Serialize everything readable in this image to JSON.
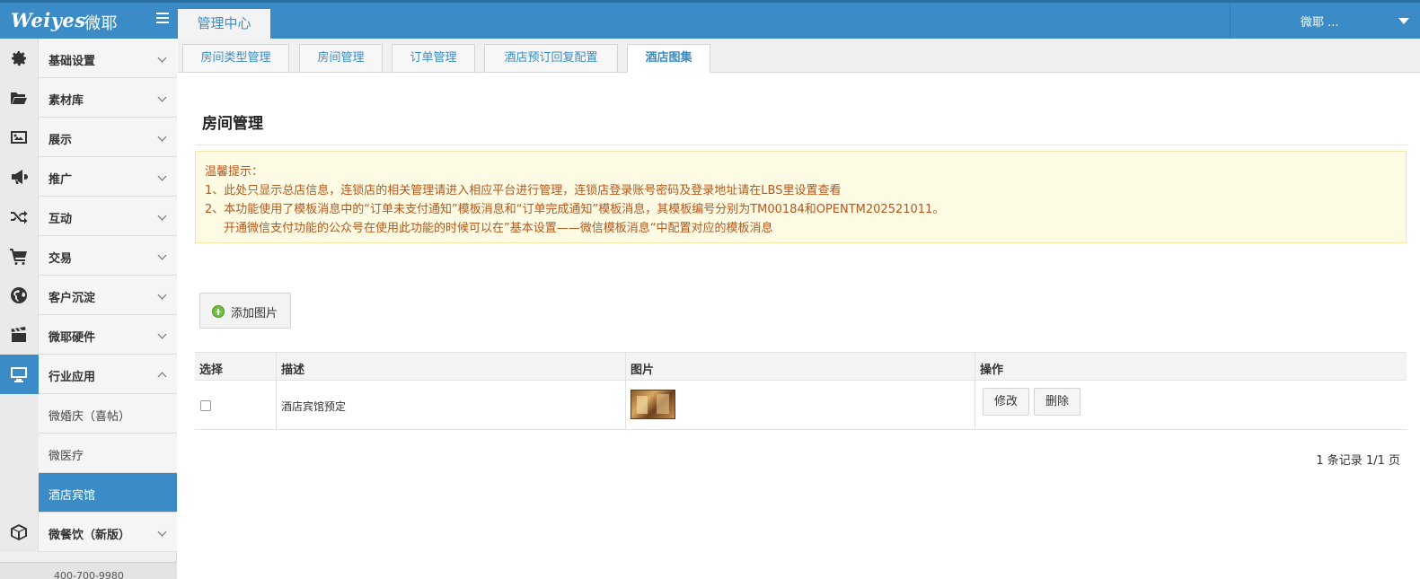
{
  "header": {
    "logo_text": "Weiyes",
    "logo_cn": "微耶",
    "active_tab": "管理中心",
    "user_name": "微耶 ..."
  },
  "sidebar": {
    "items": [
      {
        "label": "基础设置",
        "icon": "gear-icon"
      },
      {
        "label": "素材库",
        "icon": "folder-open-icon"
      },
      {
        "label": "展示",
        "icon": "image-icon"
      },
      {
        "label": "推广",
        "icon": "megaphone-icon"
      },
      {
        "label": "互动",
        "icon": "shuffle-icon"
      },
      {
        "label": "交易",
        "icon": "cart-icon"
      },
      {
        "label": "客户沉淀",
        "icon": "globe-icon"
      },
      {
        "label": "微耶硬件",
        "icon": "clapperboard-icon"
      },
      {
        "label": "行业应用",
        "icon": "monitor-icon"
      }
    ],
    "sub_items": [
      {
        "label": "微婚庆（喜帖）"
      },
      {
        "label": "微医疗"
      },
      {
        "label": "酒店宾馆"
      }
    ],
    "last_item": {
      "label": "微餐饮（新版）",
      "icon": "cube-icon"
    },
    "footer_text": "400-700-9980"
  },
  "subtabs": [
    "房间类型管理",
    "房间管理",
    "订单管理",
    "酒店预订回复配置",
    "酒店图集"
  ],
  "page": {
    "title": "房间管理",
    "notice": {
      "heading": "温馨提示：",
      "line1": "1、此处只显示总店信息，连锁店的相关管理请进入相应平台进行管理，连锁店登录账号密码及登录地址请在LBS里设置查看",
      "line2": "2、本功能使用了模板消息中的“订单未支付通知”模板消息和“订单完成通知”模板消息，其模板编号分别为TM00184和OPENTM202521011。",
      "line3": "开通微信支付功能的公众号在使用此功能的时候可以在”基本设置——微信模板消息“中配置对应的模板消息"
    },
    "add_button": "添加图片",
    "table": {
      "headers": [
        "选择",
        "描述",
        "图片",
        "操作"
      ],
      "rows": [
        {
          "desc": "酒店宾馆预定",
          "edit": "修改",
          "delete": "删除"
        }
      ]
    },
    "pager": "1 条记录 1/1 页"
  }
}
